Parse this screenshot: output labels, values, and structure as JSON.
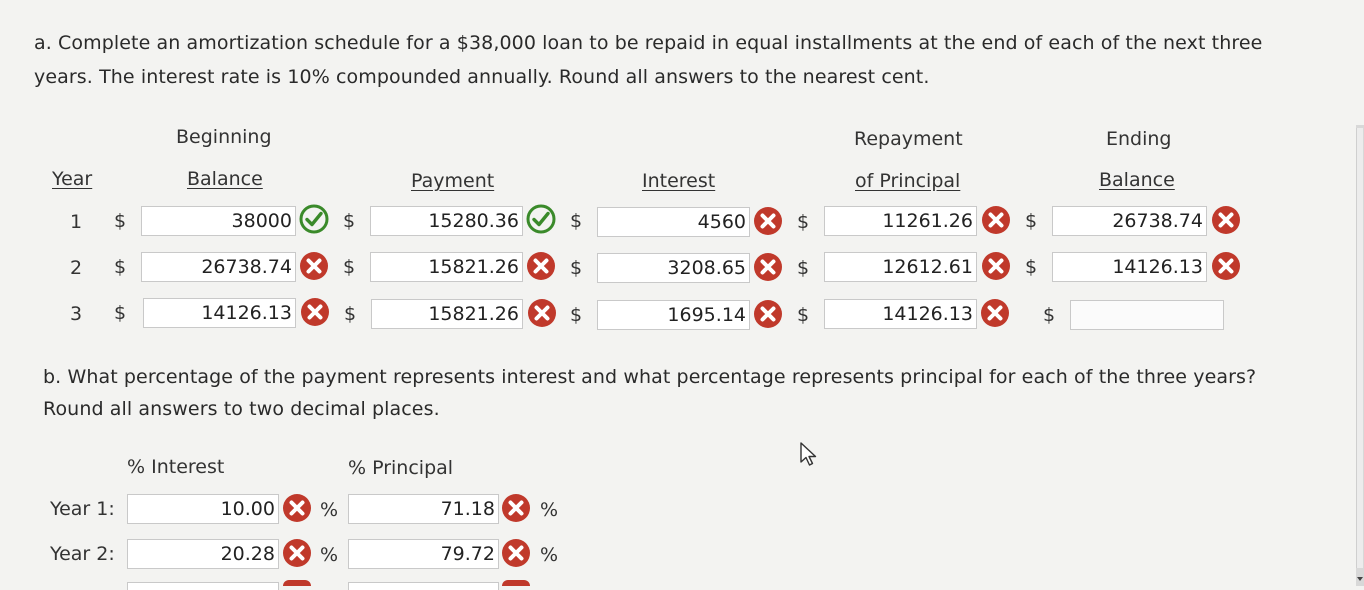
{
  "part_a": {
    "question": "a. Complete an amortization schedule for a $38,000 loan to be repaid in equal installments at the end of each of the next three years. The interest rate is 10% compounded annually. Round all answers to the nearest cent.",
    "headers": {
      "year": "Year",
      "beginning_top": "Beginning",
      "beginning_bottom": "Balance",
      "payment": "Payment",
      "interest": "Interest",
      "repayment_top": "Repayment",
      "repayment_bottom": "of Principal",
      "ending_top": "Ending",
      "ending_bottom": "Balance"
    },
    "currency_symbol": "$",
    "rows": [
      {
        "year": "1",
        "beginning": "38000",
        "payment": "15280.36",
        "interest": "4560",
        "principal": "11261.26",
        "ending": "26738.74",
        "marks": {
          "beginning": "correct",
          "payment": "correct",
          "interest": "incorrect",
          "principal": "incorrect",
          "ending": "incorrect"
        }
      },
      {
        "year": "2",
        "beginning": "26738.74",
        "payment": "15821.26",
        "interest": "3208.65",
        "principal": "12612.61",
        "ending": "14126.13",
        "marks": {
          "beginning": "incorrect",
          "payment": "incorrect",
          "interest": "incorrect",
          "principal": "incorrect",
          "ending": "incorrect"
        }
      },
      {
        "year": "3",
        "beginning": "14126.13",
        "payment": "15821.26",
        "interest": "1695.14",
        "principal": "14126.13",
        "ending": "",
        "marks": {
          "beginning": "incorrect",
          "payment": "incorrect",
          "interest": "incorrect",
          "principal": "incorrect",
          "ending": "none"
        }
      }
    ]
  },
  "part_b": {
    "question_line1": "b. What percentage of the payment represents interest and what percentage represents principal for each of the three years?",
    "question_line2": "Round all answers to two decimal places.",
    "headers": {
      "interest": "% Interest",
      "principal": "% Principal"
    },
    "percent_symbol": "%",
    "rows": [
      {
        "label": "Year 1:",
        "interest": "10.00",
        "principal": "71.18",
        "marks": {
          "interest": "incorrect",
          "principal": "incorrect"
        }
      },
      {
        "label": "Year 2:",
        "interest": "20.28",
        "principal": "79.72",
        "marks": {
          "interest": "incorrect",
          "principal": "incorrect"
        }
      }
    ]
  },
  "colors": {
    "correct": "#3a8a2a",
    "incorrect": "#c0392b"
  }
}
